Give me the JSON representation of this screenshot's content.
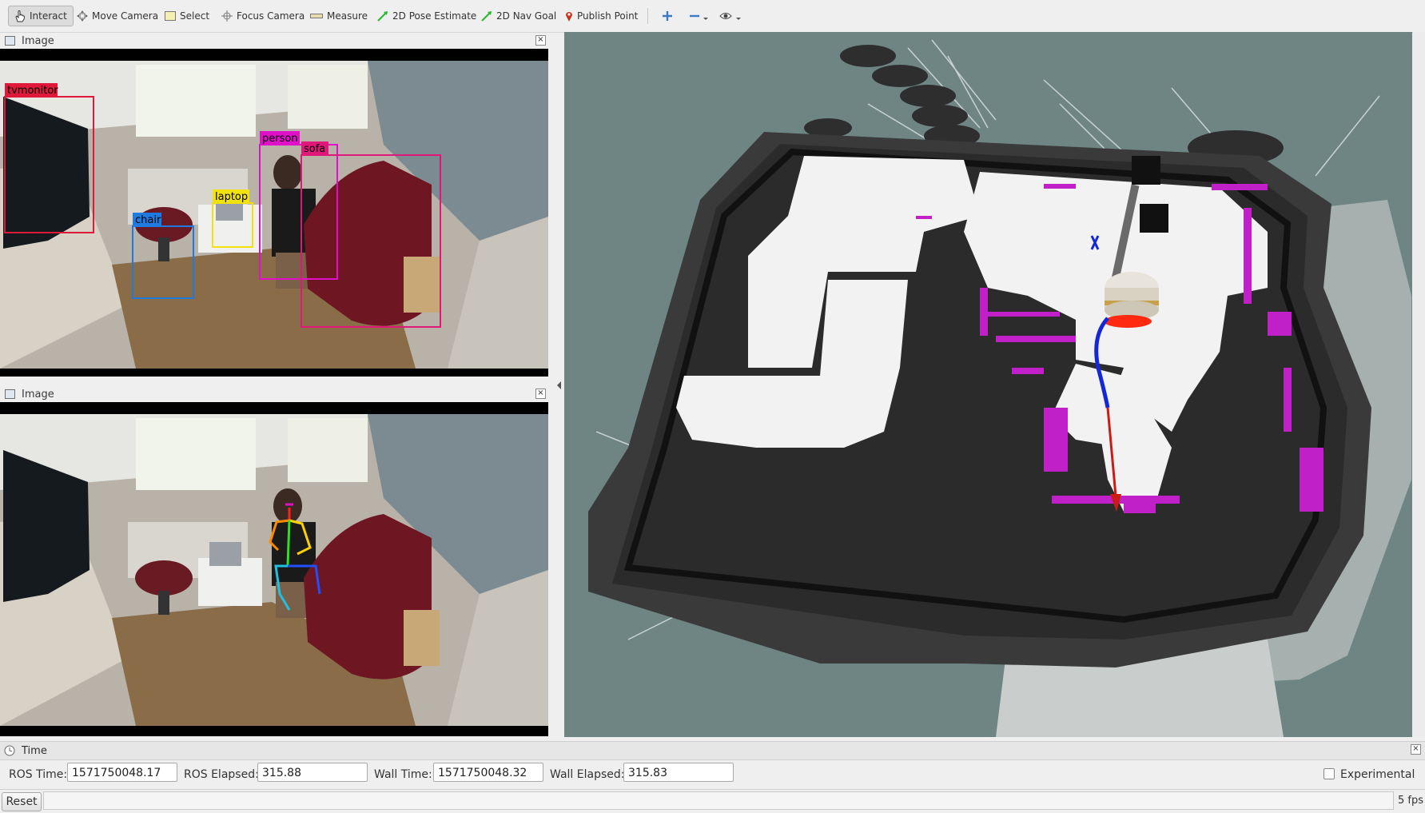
{
  "toolbar": {
    "tools": [
      {
        "label": "Interact",
        "icon": "hand-cursor-icon",
        "active": true
      },
      {
        "label": "Move Camera",
        "icon": "move-camera-icon"
      },
      {
        "label": "Select",
        "icon": "select-rect-icon"
      },
      {
        "label": "Focus Camera",
        "icon": "crosshair-icon"
      },
      {
        "label": "Measure",
        "icon": "ruler-icon"
      },
      {
        "label": "2D Pose Estimate",
        "icon": "green-arrow-icon"
      },
      {
        "label": "2D Nav Goal",
        "icon": "green-arrow-icon"
      },
      {
        "label": "Publish Point",
        "icon": "map-pin-icon"
      }
    ],
    "extra_icons": [
      "plus-icon",
      "minus-dropdown-icon",
      "eye-dropdown-icon"
    ]
  },
  "image_panels": [
    {
      "title": "Image",
      "variant": "detections"
    },
    {
      "title": "Image",
      "variant": "pose"
    }
  ],
  "detections": [
    {
      "label": "tvmonitor",
      "color": "#e0183a"
    },
    {
      "label": "chair",
      "color": "#1f7be0"
    },
    {
      "label": "laptop",
      "color": "#f2e20c"
    },
    {
      "label": "person",
      "color": "#e010c8"
    },
    {
      "label": "sofa",
      "color": "#e0187a"
    }
  ],
  "time_panel": {
    "title": "Time",
    "ros_time_label": "ROS Time:",
    "ros_time": "1571750048.17",
    "ros_elapsed_label": "ROS Elapsed:",
    "ros_elapsed": "315.88",
    "wall_time_label": "Wall Time:",
    "wall_time": "1571750048.32",
    "wall_elapsed_label": "Wall Elapsed:",
    "wall_elapsed": "315.83",
    "experimental_label": "Experimental"
  },
  "bottom": {
    "reset_label": "Reset",
    "fps": "5 fps"
  },
  "colors": {
    "map_background": "#6f8583",
    "costmap_dark": "#2b2b2b",
    "free_space": "#f2f2f2",
    "laser_points": "#c020c8",
    "global_path": "#1428d8",
    "goal_arrow": "#cc1a14"
  }
}
